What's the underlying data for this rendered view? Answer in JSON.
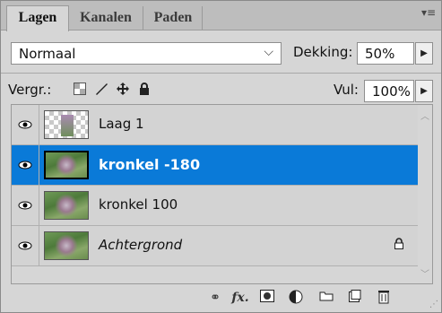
{
  "tabs": [
    {
      "label": "Lagen",
      "active": true
    },
    {
      "label": "Kanalen",
      "active": false
    },
    {
      "label": "Paden",
      "active": false
    }
  ],
  "panel_menu_icon": "panel-menu-icon",
  "blend_mode": {
    "value": "Normaal"
  },
  "opacity": {
    "label": "Dekking:",
    "value": "50%"
  },
  "lock": {
    "label": "Vergr.:",
    "icons": [
      "lock-transparency-icon",
      "lock-paint-icon",
      "lock-position-icon",
      "lock-all-icon"
    ]
  },
  "fill": {
    "label": "Vul:",
    "value": "100%"
  },
  "layers": [
    {
      "name": "Laag 1",
      "selected": false,
      "italic": false,
      "thumb": "checker",
      "locked": false
    },
    {
      "name": "kronkel -180",
      "selected": true,
      "italic": false,
      "thumb": "photo",
      "locked": false
    },
    {
      "name": "kronkel 100",
      "selected": false,
      "italic": false,
      "thumb": "photo",
      "locked": false
    },
    {
      "name": "Achtergrond",
      "selected": false,
      "italic": true,
      "thumb": "photo",
      "locked": true
    }
  ],
  "bottom_icons": [
    "link-layers-icon",
    "fx-icon",
    "add-mask-icon",
    "adjustment-layer-icon",
    "new-group-icon",
    "new-layer-icon",
    "trash-icon"
  ],
  "colors": {
    "selection": "#0a7ad8",
    "panel_bg": "#d6d6d6"
  }
}
